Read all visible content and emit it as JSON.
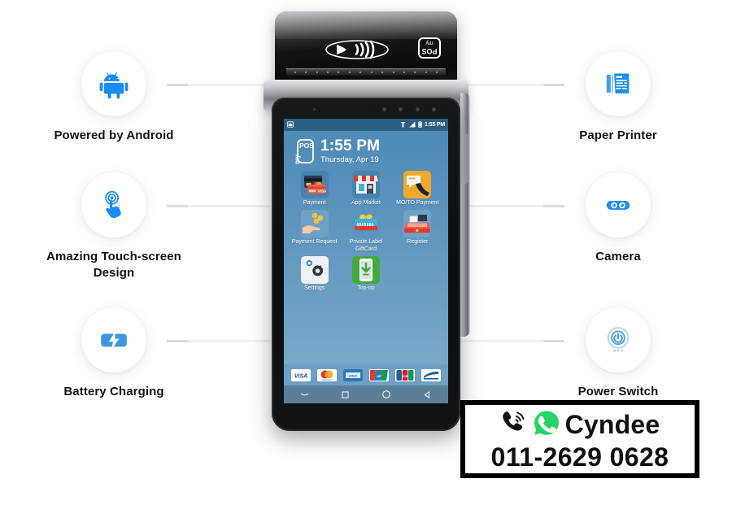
{
  "features": {
    "left": [
      {
        "id": "powered-by-android",
        "label": "Powered by Android",
        "icon": "android-icon"
      },
      {
        "id": "touchscreen-design",
        "label": "Amazing Touch-screen Design",
        "icon": "touch-gesture-icon"
      },
      {
        "id": "battery-charging",
        "label": "Battery Charging",
        "icon": "battery-charging-icon"
      }
    ],
    "right": [
      {
        "id": "paper-printer",
        "label": "Paper Printer",
        "icon": "receipt-printer-icon"
      },
      {
        "id": "camera",
        "label": "Camera",
        "icon": "camera-icon"
      },
      {
        "id": "power-switch",
        "label": "Power Switch",
        "icon": "power-switch-icon"
      }
    ]
  },
  "device": {
    "brand": "myPOS",
    "top_icons": {
      "contactless": "nfc-contactless-icon",
      "logo": "mypos-logo"
    },
    "screen": {
      "statusbar": {
        "left_icon": "screenshot-icon",
        "icons": [
          "vibrate-icon",
          "signal-icon",
          "battery-icon"
        ],
        "clock": "1:55 PM"
      },
      "clock_widget": {
        "logo": "myPOS",
        "time": "1:55 PM",
        "date": "Thursday, Apr 19"
      },
      "apps": [
        {
          "label": "Payment",
          "icon": "payment-cards-icon"
        },
        {
          "label": "App Market",
          "icon": "app-market-store-icon"
        },
        {
          "label": "MO/TO Payment",
          "icon": "moto-payment-phone-icon"
        },
        {
          "label": "Payment Request",
          "icon": "payment-request-hand-coins-icon"
        },
        {
          "label": "Private Label GiftCard",
          "icon": "giftcard-icon"
        },
        {
          "label": "Register",
          "icon": "register-cash-icon"
        },
        {
          "label": "Settings",
          "icon": "settings-gears-icon"
        },
        {
          "label": "Top-up",
          "icon": "topup-download-icon"
        }
      ],
      "card_schemes": [
        "VISA",
        "Mastercard",
        "American Express",
        "UnionPay",
        "JCB",
        "Maestro"
      ],
      "navbar": [
        "hide-keyboard-icon",
        "recents-square-icon",
        "home-circle-icon",
        "back-triangle-icon"
      ]
    }
  },
  "banner": {
    "icons": [
      "phone-ringing-icon",
      "whatsapp-icon"
    ],
    "name": "Cyndee",
    "phone": "011-2629 0628"
  },
  "colors": {
    "accent_blue": "#1a8cf5",
    "screen_blue": "#5a93bd",
    "statusbar_blue": "#2d5f84",
    "whatsapp_green": "#25d366",
    "banner_border": "#000000",
    "label_text": "#111418",
    "connector": "#f0f1f2"
  }
}
